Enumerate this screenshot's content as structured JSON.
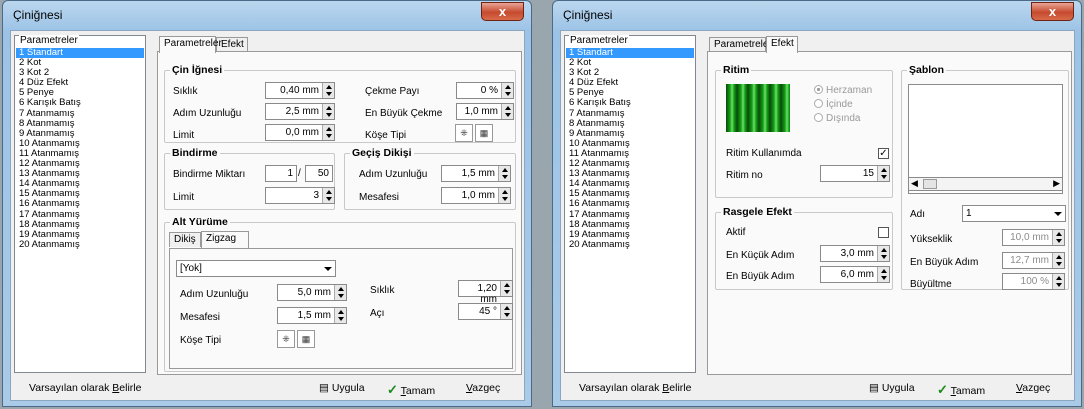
{
  "window_title": "Çiniğnesi",
  "close_glyph": "x",
  "param_header": "Parametreler",
  "params": [
    "1  Standart",
    "2  Kot",
    "3  Kot 2",
    "4  Düz Efekt",
    "5  Penye",
    "6  Karışık Batış",
    "7  Atanmamış",
    "8  Atanmamış",
    "9  Atanmamış",
    "10 Atanmamış",
    "11 Atanmamış",
    "12 Atanmamış",
    "13 Atanmamış",
    "14 Atanmamış",
    "15 Atanmamış",
    "16 Atanmamış",
    "17 Atanmamış",
    "18 Atanmamış",
    "19 Atanmamış",
    "20 Atanmamış"
  ],
  "tabs": {
    "param": "Parametreler",
    "efekt": "Efekt"
  },
  "left": {
    "cin": {
      "title": "Çin İğnesi",
      "siklik": "Sıklık",
      "siklik_v": "0,40 mm",
      "adim": "Adım Uzunluğu",
      "adim_v": "2,5 mm",
      "limit": "Limit",
      "limit_v": "0,0 mm",
      "cekme": "Çekme Payı",
      "cekme_v": "0 %",
      "enbuyuk": "En Büyük Çekme",
      "enbuyuk_v": "1,0 mm",
      "kose": "Köşe Tipi"
    },
    "bindirme": {
      "title": "Bindirme",
      "miktar": "Bindirme Miktarı",
      "m1": "1",
      "slash": "/",
      "m2": "50",
      "limit": "Limit",
      "limit_v": "3"
    },
    "gecis": {
      "title": "Geçiş Dikişi",
      "adim": "Adım Uzunluğu",
      "adim_v": "1,5 mm",
      "mesafe": "Mesafesi",
      "mesafe_v": "1,0 mm"
    },
    "alt": {
      "title": "Alt Yürüme",
      "tab1": "Dikiş",
      "tab2": "Zigzag",
      "combo": "[Yok]",
      "adim": "Adım Uzunluğu",
      "adim_v": "5,0 mm",
      "mesafe": "Mesafesi",
      "mesafe_v": "1,5 mm",
      "kose": "Köşe Tipi",
      "siklik": "Sıklık",
      "siklik_v": "1,20 mm",
      "aci": "Açı",
      "aci_v": "45 °"
    }
  },
  "right": {
    "ritim": {
      "title": "Ritim",
      "herzaman": "Herzaman",
      "icinde": "İçinde",
      "disinda": "Dışında",
      "kullan": "Ritim Kullanımda",
      "check": "✓",
      "no": "Ritim no",
      "no_v": "15"
    },
    "rasgele": {
      "title": "Rasgele Efekt",
      "aktif": "Aktif",
      "kucuk": "En Küçük Adım",
      "kucuk_v": "3,0 mm",
      "buyuk": "En Büyük Adım",
      "buyuk_v": "6,0 mm"
    },
    "sablon": {
      "title": "Şablon",
      "adi": "Adı",
      "adi_v": "1",
      "yukseklik": "Yükseklik",
      "yukseklik_v": "10,0 mm",
      "enbuyuk": "En Büyük Adım",
      "enbuyuk_v": "12,7 mm",
      "buyutme": "Büyültme",
      "buyutme_v": "100 %"
    }
  },
  "bottom": {
    "varsayilan_a": "Varsayılan olarak ",
    "varsayilan_b": "B",
    "varsayilan_c": "elirle",
    "uygula": "Uygula",
    "tamam_a": "T",
    "tamam_b": "amam",
    "vazgec_a": "V",
    "vazgec_b": "azgeç"
  }
}
